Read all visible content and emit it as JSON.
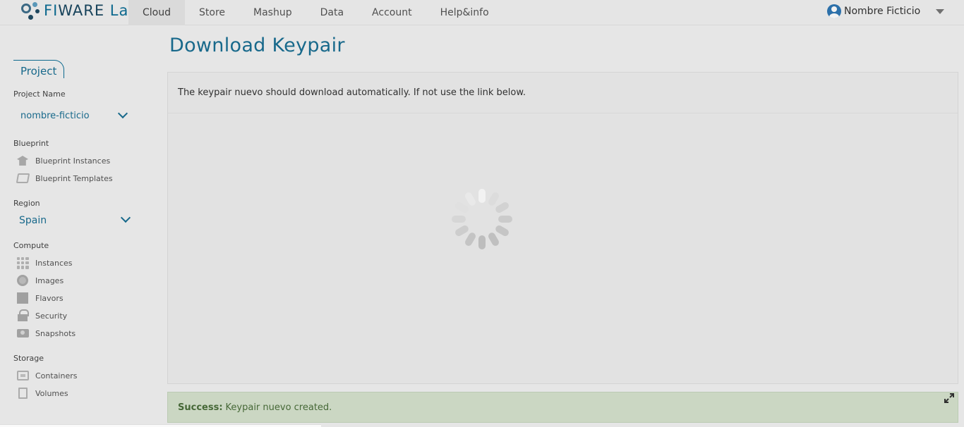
{
  "brand": {
    "logo_text_a": "FI",
    "logo_text_b": "WARE",
    "logo_text_c": " Lab"
  },
  "nav": {
    "items": [
      "Cloud",
      "Store",
      "Mashup",
      "Data",
      "Account",
      "Help&info"
    ],
    "active": "Cloud"
  },
  "user": {
    "name": "Nombre Ficticio"
  },
  "sidebar": {
    "tab": "Project",
    "project_name_label": "Project Name",
    "project_name_value": "nombre-ficticio",
    "blueprint_label": "Blueprint",
    "blueprint_items": [
      {
        "label": "Blueprint Instances",
        "icon": "graduation-cap-icon"
      },
      {
        "label": "Blueprint Templates",
        "icon": "layers-icon"
      }
    ],
    "region_label": "Region",
    "region_value": "Spain",
    "compute_label": "Compute",
    "compute_items": [
      {
        "label": "Instances",
        "icon": "grid-icon"
      },
      {
        "label": "Images",
        "icon": "disc-icon"
      },
      {
        "label": "Flavors",
        "icon": "square-icon"
      },
      {
        "label": "Security",
        "icon": "lock-icon"
      },
      {
        "label": "Snapshots",
        "icon": "camera-icon"
      }
    ],
    "storage_label": "Storage",
    "storage_items": [
      {
        "label": "Containers",
        "icon": "box-icon"
      },
      {
        "label": "Volumes",
        "icon": "document-icon"
      }
    ]
  },
  "main": {
    "title": "Download Keypair",
    "message": "The keypair nuevo should download automatically. If not use the link below.",
    "loading": true
  },
  "alert": {
    "label": "Success:",
    "message": "Keypair nuevo created."
  },
  "colors": {
    "accent": "#1a6f93",
    "success_bg": "#d6e3ce",
    "success_text": "#4a6e3a"
  }
}
